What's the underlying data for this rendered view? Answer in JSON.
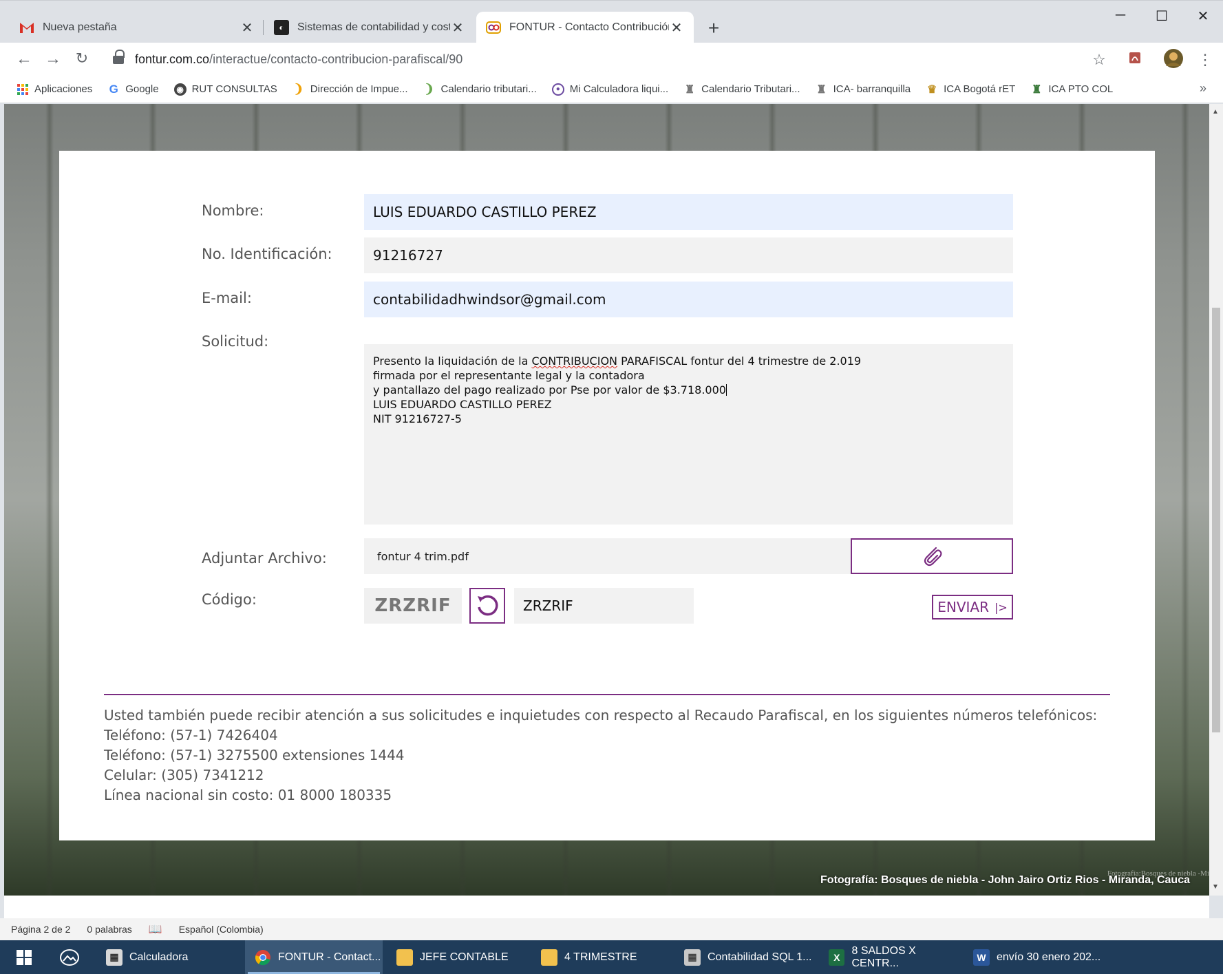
{
  "browser": {
    "tabs": [
      {
        "title": "Nueva pestaña",
        "icon": "gmail-icon"
      },
      {
        "title": "Sistemas de contabilidad y costos",
        "icon": "site-icon"
      },
      {
        "title": "FONTUR - Contacto Contribución Parafiscal",
        "icon": "fontur-icon",
        "active": true
      }
    ],
    "window_controls": {
      "minimize": "─",
      "maximize": "☐",
      "close": "✕"
    },
    "url_host": "fontur.com.co",
    "url_path": "/interactue/contacto-contribucion-parafiscal/90",
    "bookmarks": [
      {
        "label": "Aplicaciones",
        "icon": "apps-grid-icon",
        "color": "#e8453c"
      },
      {
        "label": "Google",
        "icon": "google-icon",
        "color": "#4285f4"
      },
      {
        "label": "RUT CONSULTAS",
        "icon": "globe-icon",
        "color": "#444444"
      },
      {
        "label": "Dirección de Impue...",
        "icon": "dian-icon",
        "color": "#f0a30a"
      },
      {
        "label": "Calendario tributari...",
        "icon": "dian-icon",
        "color": "#6aa84f"
      },
      {
        "label": "Mi Calculadora liqui...",
        "icon": "seal-icon",
        "color": "#6b4aa0"
      },
      {
        "label": "Calendario Tributari...",
        "icon": "crest-icon",
        "color": "#777777"
      },
      {
        "label": "ICA- barranquilla",
        "icon": "crest-icon",
        "color": "#777777"
      },
      {
        "label": "ICA Bogotá rET",
        "icon": "bogota-crest-icon",
        "color": "#c09020"
      },
      {
        "label": "ICA PTO COL",
        "icon": "crest-icon",
        "color": "#3b7a3b"
      }
    ],
    "bookmarks_more": "»"
  },
  "form": {
    "nombre_label": "Nombre:",
    "nombre_value": "LUIS EDUARDO CASTILLO PEREZ",
    "id_label": "No. Identificación:",
    "id_value": "91216727",
    "email_label": "E-mail:",
    "email_value": "contabilidadhwindsor@gmail.com",
    "solicitud_label": "Solicitud:",
    "solicitud_lines": [
      "Presento la liquidación de la ",
      "CONTRIBUCION",
      " PARAFISCAL fontur del 4 trimestre de 2.019",
      "firmada por el representante legal y la contadora",
      "y pantallazo del pago realizado por Pse por valor de $3.718.000",
      "LUIS EDUARDO CASTILLO PEREZ",
      "NIT 91216727-5"
    ],
    "adjuntar_label": "Adjuntar Archivo:",
    "file_name": "fontur 4 trim.pdf",
    "codigo_label": "Código:",
    "captcha_text": "ZRZRIF",
    "captcha_input": "ZRZRIF",
    "send_label": "ENVIAR",
    "send_arrow": "|>"
  },
  "info": {
    "intro": "Usted también puede recibir atención a sus solicitudes e inquietudes con respecto al Recaudo Parafiscal, en los siguientes números telefónicos:",
    "tel1": "Teléfono: (57-1) 7426404",
    "tel2": "Teléfono: (57-1) 3275500 extensiones 1444",
    "cel": "Celular: (305) 7341212",
    "linea": "Línea nacional sin costo: 01 8000 180335"
  },
  "photo_credit": "Fotografía: Bosques de niebla - John Jairo Ortiz Rios - Miranda, Cauca",
  "photo_credit_faint": "Fotografía:Bosques de niebla -Mi",
  "word_status": {
    "page": "Página 2 de 2",
    "words": "0 palabras",
    "language": "Español (Colombia)"
  },
  "taskbar": [
    {
      "label": "Calculadora",
      "icon": "calculator-icon",
      "color": "#555555"
    },
    {
      "label": "FONTUR - Contact...",
      "icon": "chrome-icon",
      "color": "#4285f4",
      "active": true
    },
    {
      "label": "JEFE CONTABLE",
      "icon": "folder-icon",
      "color": "#f2c14e"
    },
    {
      "label": "4 TRIMESTRE",
      "icon": "folder-icon",
      "color": "#f2c14e"
    },
    {
      "label": "Contabilidad SQL 1...",
      "icon": "calculator-icon",
      "color": "#777777"
    },
    {
      "label": "8 SALDOS X CENTR...",
      "icon": "excel-icon",
      "color": "#1d6f42"
    },
    {
      "label": "envío 30 enero 202...",
      "icon": "word-icon",
      "color": "#2b579a"
    }
  ],
  "colors": {
    "accent": "#7b2d82",
    "autofill": "#e8f0fe",
    "field": "#f2f2f2"
  }
}
